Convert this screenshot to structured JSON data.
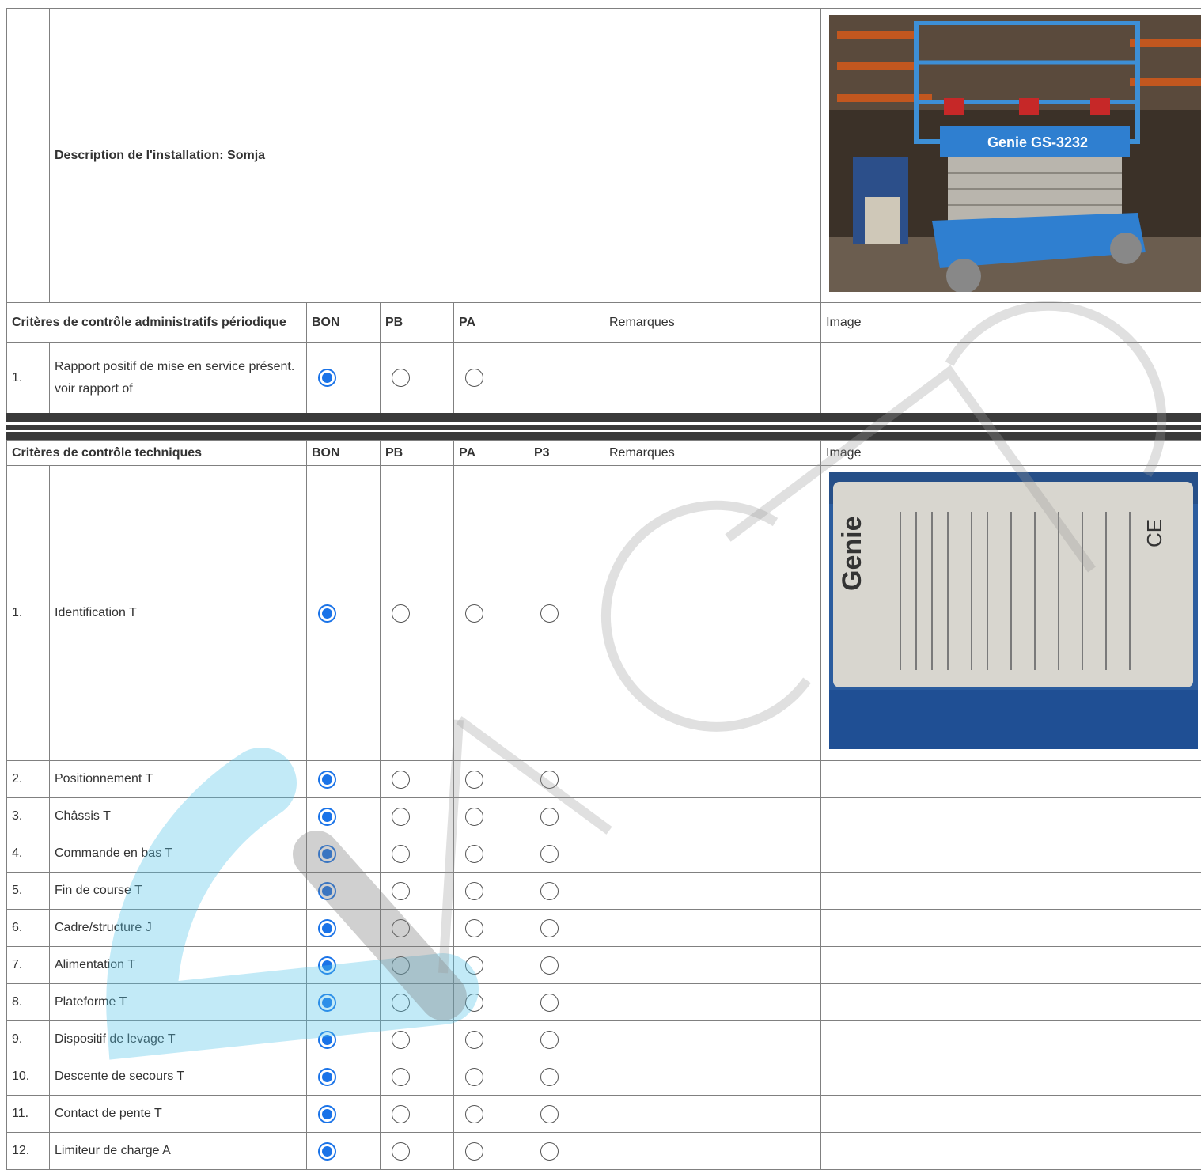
{
  "installation": {
    "label": "Description de l'installation: Somja",
    "photo_icon": "scissor-lift-photo"
  },
  "admin": {
    "header": {
      "title": "Critères de contrôle administratifs périodique",
      "bon": "BON",
      "pb": "PB",
      "pa": "PA",
      "p3": "",
      "remarks": "Remarques",
      "image": "Image"
    },
    "rows": [
      {
        "num": "1.",
        "label": "Rapport positif de mise en service présent.",
        "note": "voir rapport of",
        "selected": "BON"
      }
    ]
  },
  "tech": {
    "header": {
      "title": "Critères de contrôle techniques",
      "bon": "BON",
      "pb": "PB",
      "pa": "PA",
      "p3": "P3",
      "remarks": "Remarques",
      "image": "Image"
    },
    "rows": [
      {
        "num": "1.",
        "label": "Identification T",
        "selected": "BON",
        "image_icon": "identification-plate-photo"
      },
      {
        "num": "2.",
        "label": "Positionnement T",
        "selected": "BON"
      },
      {
        "num": "3.",
        "label": "Châssis T",
        "selected": "BON"
      },
      {
        "num": "4.",
        "label": "Commande en bas T",
        "selected": "BON"
      },
      {
        "num": "5.",
        "label": "Fin de course T",
        "selected": "BON"
      },
      {
        "num": "6.",
        "label": "Cadre/structure J",
        "selected": "BON"
      },
      {
        "num": "7.",
        "label": "Alimentation T",
        "selected": "BON"
      },
      {
        "num": "8.",
        "label": "Plateforme T",
        "selected": "BON"
      },
      {
        "num": "9.",
        "label": "Dispositif de levage T",
        "selected": "BON"
      },
      {
        "num": "10.",
        "label": "Descente de secours T",
        "selected": "BON"
      },
      {
        "num": "11.",
        "label": "Contact de pente T",
        "selected": "BON"
      },
      {
        "num": "12.",
        "label": "Limiteur de charge A",
        "selected": "BON"
      }
    ]
  },
  "watermark": {
    "icon": "company-watermark-logo",
    "color_primary": "#4fc3e8",
    "color_secondary": "#888888"
  }
}
